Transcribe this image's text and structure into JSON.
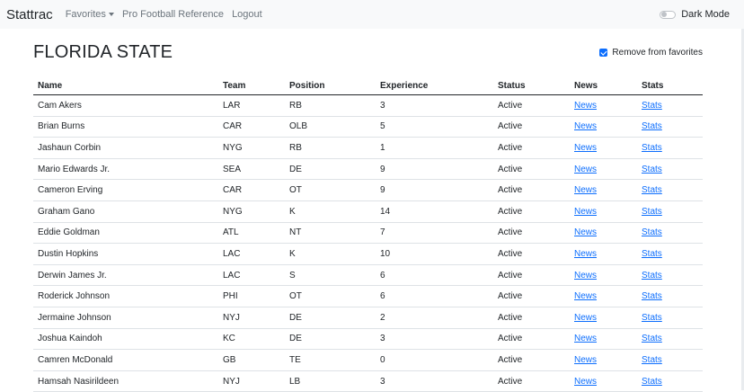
{
  "navbar": {
    "brand": "Stattrac",
    "favorites": "Favorites",
    "pfr": "Pro Football Reference",
    "logout": "Logout",
    "dark_mode": "Dark Mode"
  },
  "page": {
    "title": "FLORIDA STATE",
    "favorite_label": "Remove from favorites"
  },
  "table": {
    "headers": [
      "Name",
      "Team",
      "Position",
      "Experience",
      "Status",
      "News",
      "Stats"
    ],
    "rows": [
      [
        "Cam Akers",
        "LAR",
        "RB",
        "3",
        "Active",
        "News",
        "Stats"
      ],
      [
        "Brian Burns",
        "CAR",
        "OLB",
        "5",
        "Active",
        "News",
        "Stats"
      ],
      [
        "Jashaun Corbin",
        "NYG",
        "RB",
        "1",
        "Active",
        "News",
        "Stats"
      ],
      [
        "Mario Edwards Jr.",
        "SEA",
        "DE",
        "9",
        "Active",
        "News",
        "Stats"
      ],
      [
        "Cameron Erving",
        "CAR",
        "OT",
        "9",
        "Active",
        "News",
        "Stats"
      ],
      [
        "Graham Gano",
        "NYG",
        "K",
        "14",
        "Active",
        "News",
        "Stats"
      ],
      [
        "Eddie Goldman",
        "ATL",
        "NT",
        "7",
        "Active",
        "News",
        "Stats"
      ],
      [
        "Dustin Hopkins",
        "LAC",
        "K",
        "10",
        "Active",
        "News",
        "Stats"
      ],
      [
        "Derwin James Jr.",
        "LAC",
        "S",
        "6",
        "Active",
        "News",
        "Stats"
      ],
      [
        "Roderick Johnson",
        "PHI",
        "OT",
        "6",
        "Active",
        "News",
        "Stats"
      ],
      [
        "Jermaine Johnson",
        "NYJ",
        "DE",
        "2",
        "Active",
        "News",
        "Stats"
      ],
      [
        "Joshua Kaindoh",
        "KC",
        "DE",
        "3",
        "Active",
        "News",
        "Stats"
      ],
      [
        "Camren McDonald",
        "GB",
        "TE",
        "0",
        "Active",
        "News",
        "Stats"
      ],
      [
        "Hamsah Nasirildeen",
        "NYJ",
        "LB",
        "3",
        "Active",
        "News",
        "Stats"
      ]
    ]
  },
  "colors": {
    "link": "#0d6efd",
    "navbar_bg": "#f8f9fa"
  }
}
